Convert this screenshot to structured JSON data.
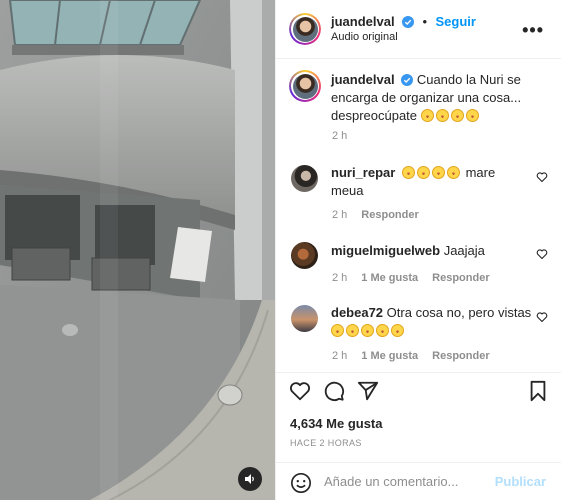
{
  "post": {
    "username": "juandelval",
    "follow_label": "Seguir",
    "dot": "•",
    "audio": "Audio original",
    "more": "•••"
  },
  "caption": {
    "username": "juandelval",
    "text": "Cuando la Nuri se encarga de organizar una cosa... despreocúpate",
    "emoji_count": 4,
    "time": "2 h"
  },
  "comments": [
    {
      "username": "nuri_repar",
      "emoji_count": 4,
      "text": "mare meua",
      "time": "2 h",
      "likes": "",
      "reply": "Responder"
    },
    {
      "username": "miguelmiguelweb",
      "text": "Jaajaja",
      "time": "2 h",
      "likes": "1 Me gusta",
      "reply": "Responder"
    },
    {
      "username": "debea72",
      "text": "Otra cosa no, pero vistas",
      "emoji_count": 5,
      "time": "2 h",
      "likes": "1 Me gusta",
      "reply": "Responder"
    }
  ],
  "stats": {
    "likes": "4,634 Me gusta",
    "ago": "HACE 2 HORAS"
  },
  "composer": {
    "placeholder": "Añade un comentario...",
    "publish": "Publicar"
  },
  "icons": {
    "like": "heart-icon",
    "comment": "comment-bubble-icon",
    "share": "paper-plane-icon",
    "save": "bookmark-icon",
    "emoji": "smiley-icon",
    "mute": "speaker-icon",
    "more": "more-options-icon",
    "verified": "verified-badge-icon"
  },
  "colors": {
    "accent": "#0095f6",
    "verified": "#3897f0",
    "muted": "#8e8e8e",
    "publish_disabled": "#b2dffc"
  }
}
